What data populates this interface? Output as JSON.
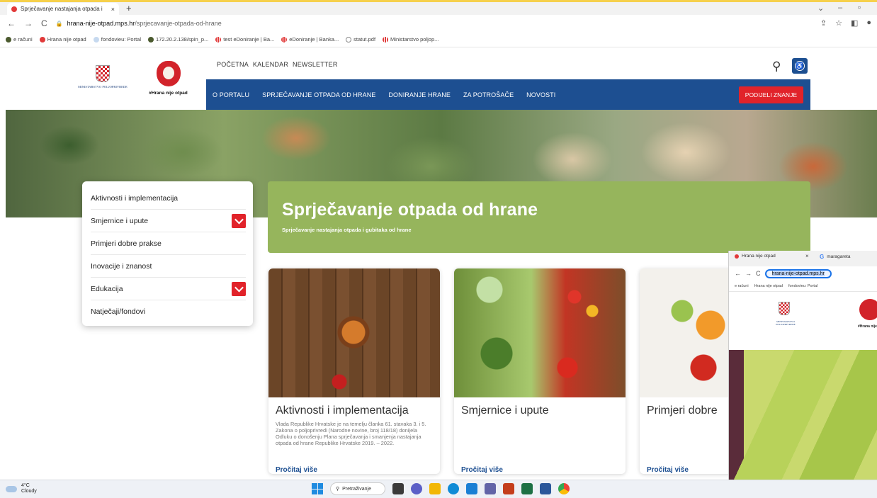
{
  "browser": {
    "tab_title": "Sprječavanje nastajanja otpada i",
    "tab_close": "×",
    "new_tab": "+",
    "url_host": "hrana-nije-otpad.mps.hr",
    "url_path": "/sprjecavanje-otpada-od-hrane",
    "bookmarks": [
      "e računi",
      "Hrana nije otpad",
      "fondovieu: Portal",
      "172.20.2.138/spin_p...",
      "test eDoniranje | Ba...",
      "eDoniranje | Banka...",
      "statut.pdf",
      "Ministarstvo poljop..."
    ]
  },
  "header": {
    "ministry_text": "MINISTARSTVO POLJOPRIVREDE",
    "hrana_logo_text": "#Hrana nije otpad",
    "top_links": [
      "POČETNA",
      "KALENDAR",
      "NEWSLETTER"
    ],
    "main_nav": [
      "O PORTALU",
      "SPRJEČAVANJE OTPADA OD HRANE",
      "DONIRANJE HRANE",
      "ZA POTROŠAČE",
      "NOVOSTI"
    ],
    "share_button": "PODIJELI ZNANJE"
  },
  "sidemenu": {
    "items": [
      "Aktivnosti i implementacija",
      "Smjernice i upute",
      "Primjeri dobre prakse",
      "Inovacije i znanost",
      "Edukacija",
      "Natječaji/fondovi"
    ]
  },
  "hero": {
    "title": "Sprječavanje otpada od hrane",
    "subtitle": "Sprječavanje nastajanja otpada i gubitaka od hrane"
  },
  "cards": [
    {
      "title": "Aktivnosti i implementacija",
      "desc": "Vlada Republike Hrvatske je na temelju članka 61. stavaka 3. i 5. Zakona o poljoprivredi (Narodne novine, broj 118/18) donijela Odluku o donošenju Plana sprječavanja i smanjenja nastajanja otpada od hrane Republike Hrvatske 2019. – 2022.",
      "more": "Pročitaj više"
    },
    {
      "title": "Smjernice i upute",
      "desc": "",
      "more": "Pročitaj više"
    },
    {
      "title": "Primjeri dobre",
      "desc": "",
      "more": "Pročitaj više"
    }
  ],
  "overlay": {
    "tab_title": "Hrana nije otpad",
    "tab_close": "×",
    "tab2_title": "maragareta",
    "url": "hrana-nije-otpad.mps.hr",
    "bookmarks": [
      "e računi",
      "Hrana nije otpad",
      "fondovieu: Portal"
    ],
    "ministry_text": "MINISTARSTVO POLJOPRIVREDE",
    "hrana_text": "#Hrana nije"
  },
  "taskbar": {
    "temperature": "4°C",
    "condition": "Cloudy",
    "search_label": "Pretraživanje"
  },
  "colors": {
    "brand_blue": "#1d4f91",
    "accent_red": "#e1232a",
    "hero_green": "#96b55c"
  }
}
